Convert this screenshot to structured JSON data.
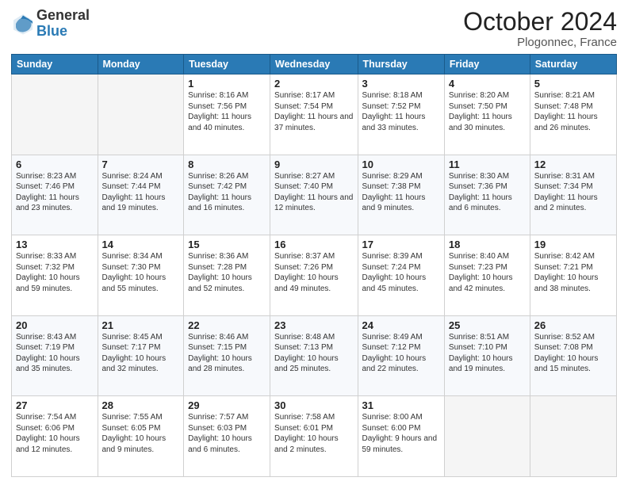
{
  "header": {
    "logo_general": "General",
    "logo_blue": "Blue",
    "month_title": "October 2024",
    "location": "Plogonnec, France"
  },
  "weekdays": [
    "Sunday",
    "Monday",
    "Tuesday",
    "Wednesday",
    "Thursday",
    "Friday",
    "Saturday"
  ],
  "weeks": [
    [
      {
        "day": "",
        "info": ""
      },
      {
        "day": "",
        "info": ""
      },
      {
        "day": "1",
        "info": "Sunrise: 8:16 AM\nSunset: 7:56 PM\nDaylight: 11 hours and 40 minutes."
      },
      {
        "day": "2",
        "info": "Sunrise: 8:17 AM\nSunset: 7:54 PM\nDaylight: 11 hours and 37 minutes."
      },
      {
        "day": "3",
        "info": "Sunrise: 8:18 AM\nSunset: 7:52 PM\nDaylight: 11 hours and 33 minutes."
      },
      {
        "day": "4",
        "info": "Sunrise: 8:20 AM\nSunset: 7:50 PM\nDaylight: 11 hours and 30 minutes."
      },
      {
        "day": "5",
        "info": "Sunrise: 8:21 AM\nSunset: 7:48 PM\nDaylight: 11 hours and 26 minutes."
      }
    ],
    [
      {
        "day": "6",
        "info": "Sunrise: 8:23 AM\nSunset: 7:46 PM\nDaylight: 11 hours and 23 minutes."
      },
      {
        "day": "7",
        "info": "Sunrise: 8:24 AM\nSunset: 7:44 PM\nDaylight: 11 hours and 19 minutes."
      },
      {
        "day": "8",
        "info": "Sunrise: 8:26 AM\nSunset: 7:42 PM\nDaylight: 11 hours and 16 minutes."
      },
      {
        "day": "9",
        "info": "Sunrise: 8:27 AM\nSunset: 7:40 PM\nDaylight: 11 hours and 12 minutes."
      },
      {
        "day": "10",
        "info": "Sunrise: 8:29 AM\nSunset: 7:38 PM\nDaylight: 11 hours and 9 minutes."
      },
      {
        "day": "11",
        "info": "Sunrise: 8:30 AM\nSunset: 7:36 PM\nDaylight: 11 hours and 6 minutes."
      },
      {
        "day": "12",
        "info": "Sunrise: 8:31 AM\nSunset: 7:34 PM\nDaylight: 11 hours and 2 minutes."
      }
    ],
    [
      {
        "day": "13",
        "info": "Sunrise: 8:33 AM\nSunset: 7:32 PM\nDaylight: 10 hours and 59 minutes."
      },
      {
        "day": "14",
        "info": "Sunrise: 8:34 AM\nSunset: 7:30 PM\nDaylight: 10 hours and 55 minutes."
      },
      {
        "day": "15",
        "info": "Sunrise: 8:36 AM\nSunset: 7:28 PM\nDaylight: 10 hours and 52 minutes."
      },
      {
        "day": "16",
        "info": "Sunrise: 8:37 AM\nSunset: 7:26 PM\nDaylight: 10 hours and 49 minutes."
      },
      {
        "day": "17",
        "info": "Sunrise: 8:39 AM\nSunset: 7:24 PM\nDaylight: 10 hours and 45 minutes."
      },
      {
        "day": "18",
        "info": "Sunrise: 8:40 AM\nSunset: 7:23 PM\nDaylight: 10 hours and 42 minutes."
      },
      {
        "day": "19",
        "info": "Sunrise: 8:42 AM\nSunset: 7:21 PM\nDaylight: 10 hours and 38 minutes."
      }
    ],
    [
      {
        "day": "20",
        "info": "Sunrise: 8:43 AM\nSunset: 7:19 PM\nDaylight: 10 hours and 35 minutes."
      },
      {
        "day": "21",
        "info": "Sunrise: 8:45 AM\nSunset: 7:17 PM\nDaylight: 10 hours and 32 minutes."
      },
      {
        "day": "22",
        "info": "Sunrise: 8:46 AM\nSunset: 7:15 PM\nDaylight: 10 hours and 28 minutes."
      },
      {
        "day": "23",
        "info": "Sunrise: 8:48 AM\nSunset: 7:13 PM\nDaylight: 10 hours and 25 minutes."
      },
      {
        "day": "24",
        "info": "Sunrise: 8:49 AM\nSunset: 7:12 PM\nDaylight: 10 hours and 22 minutes."
      },
      {
        "day": "25",
        "info": "Sunrise: 8:51 AM\nSunset: 7:10 PM\nDaylight: 10 hours and 19 minutes."
      },
      {
        "day": "26",
        "info": "Sunrise: 8:52 AM\nSunset: 7:08 PM\nDaylight: 10 hours and 15 minutes."
      }
    ],
    [
      {
        "day": "27",
        "info": "Sunrise: 7:54 AM\nSunset: 6:06 PM\nDaylight: 10 hours and 12 minutes."
      },
      {
        "day": "28",
        "info": "Sunrise: 7:55 AM\nSunset: 6:05 PM\nDaylight: 10 hours and 9 minutes."
      },
      {
        "day": "29",
        "info": "Sunrise: 7:57 AM\nSunset: 6:03 PM\nDaylight: 10 hours and 6 minutes."
      },
      {
        "day": "30",
        "info": "Sunrise: 7:58 AM\nSunset: 6:01 PM\nDaylight: 10 hours and 2 minutes."
      },
      {
        "day": "31",
        "info": "Sunrise: 8:00 AM\nSunset: 6:00 PM\nDaylight: 9 hours and 59 minutes."
      },
      {
        "day": "",
        "info": ""
      },
      {
        "day": "",
        "info": ""
      }
    ]
  ]
}
